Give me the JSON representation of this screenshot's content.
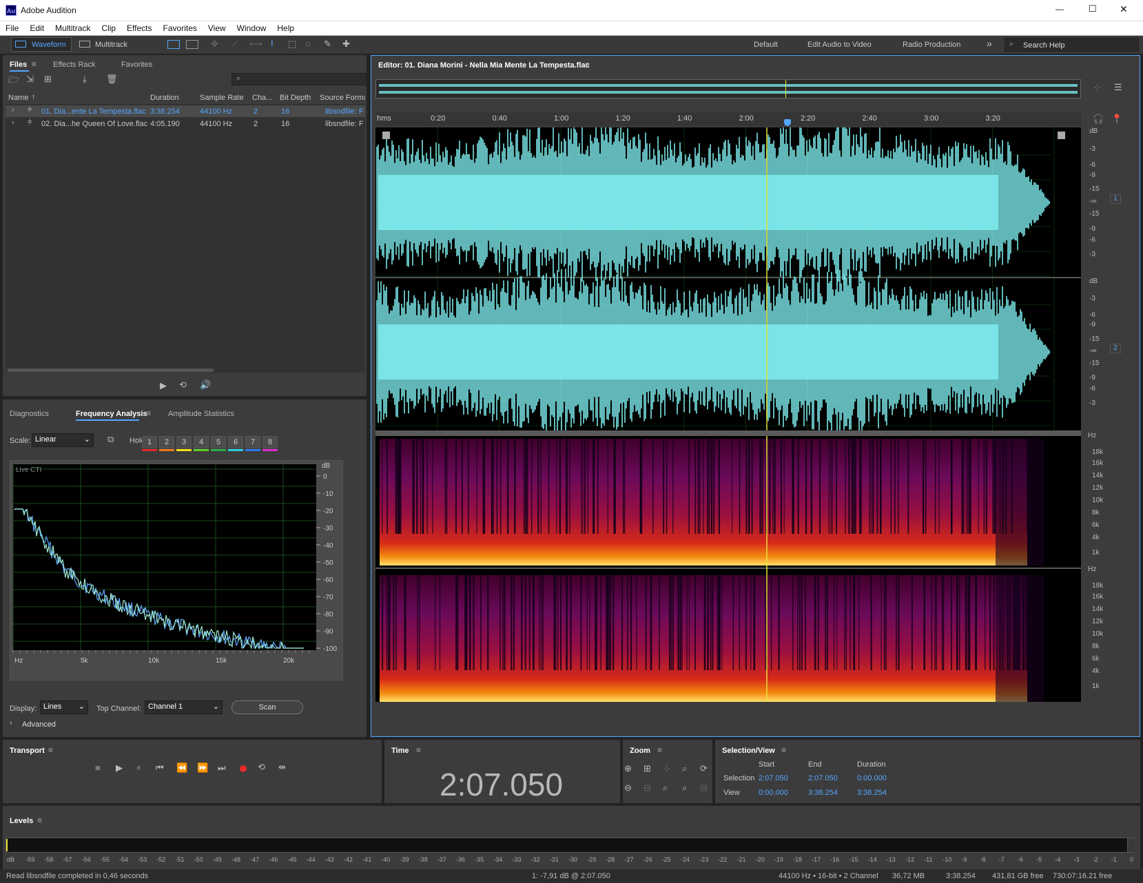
{
  "app": {
    "title": "Adobe Audition",
    "logo": "Au"
  },
  "window_controls": {
    "minimize": "—",
    "maximize": "☐",
    "close": "✕"
  },
  "menu": [
    "File",
    "Edit",
    "Multitrack",
    "Clip",
    "Effects",
    "Favorites",
    "View",
    "Window",
    "Help"
  ],
  "toolbar": {
    "waveform_label": "Waveform",
    "multitrack_label": "Multitrack",
    "workspaces": [
      "Default",
      "Edit Audio to Video",
      "Radio Production"
    ],
    "more": "»",
    "search_placeholder": "Search Help"
  },
  "files_panel": {
    "tabs": [
      "Files",
      "Effects Rack",
      "Favorites"
    ],
    "columns": [
      "Name",
      "Duration",
      "Sample Rate",
      "Cha...",
      "Bit Depth",
      "Source Forma"
    ],
    "rows": [
      {
        "name": "01. Dia...ente La Tempesta.flac",
        "duration": "3:38.254",
        "rate": "44100 Hz",
        "ch": "2",
        "bits": "16",
        "format": "libsndfile: FL"
      },
      {
        "name": "02. Dia...he Queen Of Love.flac",
        "duration": "4:05.190",
        "rate": "44100 Hz",
        "ch": "2",
        "bits": "16",
        "format": "libsndfile: FL"
      }
    ]
  },
  "analysis_panel": {
    "tabs": [
      "Diagnostics",
      "Frequency Analysis",
      "Amplitude Statistics"
    ],
    "scale_label": "Scale:",
    "scale_value": "Linear",
    "hold_label": "Hold:",
    "hold": [
      "1",
      "2",
      "3",
      "4",
      "5",
      "6",
      "7",
      "8"
    ],
    "hold_colors": [
      "#e0282a",
      "#f07c1a",
      "#f4e01a",
      "#5cd02a",
      "#2ab04a",
      "#2ad0e0",
      "#2a7cf0",
      "#e02ad0"
    ],
    "graph_label": "Live CTI",
    "db_unit": "dB",
    "db_ticks": [
      "0",
      "-10",
      "-20",
      "-30",
      "-40",
      "-50",
      "-60",
      "-70",
      "-80",
      "-90",
      "-100"
    ],
    "hz_ticks": [
      "Hz",
      "5k",
      "10k",
      "15k",
      "20k"
    ],
    "display_label": "Display:",
    "display_value": "Lines",
    "top_channel_label": "Top Channel:",
    "top_channel_value": "Channel 1",
    "scan_label": "Scan",
    "advanced_label": "Advanced"
  },
  "editor": {
    "title": "Editor: 01. Diana Morini - Nella Mia Mente La Tempesta.flac",
    "ruler_unit": "hms",
    "ruler": [
      "0:20",
      "0:40",
      "1:00",
      "1:20",
      "1:40",
      "2:00",
      "2:20",
      "2:40",
      "3:00",
      "3:20"
    ],
    "db_unit": "dB",
    "db_scale": [
      "-3",
      "-6",
      "-9",
      "-15",
      "-∞",
      "-15",
      "-9",
      "-6",
      "-3"
    ],
    "channel_badges": [
      "1",
      "2"
    ],
    "hz_unit": "Hz",
    "hz_scale": [
      "18k",
      "16k",
      "14k",
      "12k",
      "10k",
      "8k",
      "6k",
      "4k",
      "1k"
    ],
    "waveform_color": "#7ae4e6",
    "playhead_color": "#e8e23a"
  },
  "transport": {
    "title": "Transport"
  },
  "time": {
    "title": "Time",
    "value": "2:07.050"
  },
  "zoom": {
    "title": "Zoom"
  },
  "selection_view": {
    "title": "Selection/View",
    "headers": [
      "Start",
      "End",
      "Duration"
    ],
    "rows": [
      {
        "label": "Selection",
        "start": "2:07.050",
        "end": "2:07.050",
        "duration": "0:00.000"
      },
      {
        "label": "View",
        "start": "0:00.000",
        "end": "3:38.254",
        "duration": "3:38.254"
      }
    ]
  },
  "levels": {
    "title": "Levels",
    "scale": [
      "dB",
      "-59",
      "-58",
      "-57",
      "-56",
      "-55",
      "-54",
      "-53",
      "-52",
      "-51",
      "-50",
      "-49",
      "-48",
      "-47",
      "-46",
      "-45",
      "-44",
      "-43",
      "-42",
      "-41",
      "-40",
      "-39",
      "-38",
      "-37",
      "-36",
      "-35",
      "-34",
      "-33",
      "-32",
      "-31",
      "-30",
      "-29",
      "-28",
      "-27",
      "-26",
      "-25",
      "-24",
      "-23",
      "-22",
      "-21",
      "-20",
      "-19",
      "-18",
      "-17",
      "-16",
      "-15",
      "-14",
      "-13",
      "-12",
      "-11",
      "-10",
      "-9",
      "-8",
      "-7",
      "-6",
      "-5",
      "-4",
      "-3",
      "-2",
      "-1",
      "0"
    ]
  },
  "status": {
    "message": "Read libsndfile completed in 0,46 seconds",
    "cursor": "1: -7,91 dB @ 2:07.050",
    "format": "44100 Hz • 16-bit • 2 Channel",
    "size": "36,72 MB",
    "duration": "3:38.254",
    "free": "431,81 GB free",
    "time_free": "730:07:16.21 free"
  }
}
